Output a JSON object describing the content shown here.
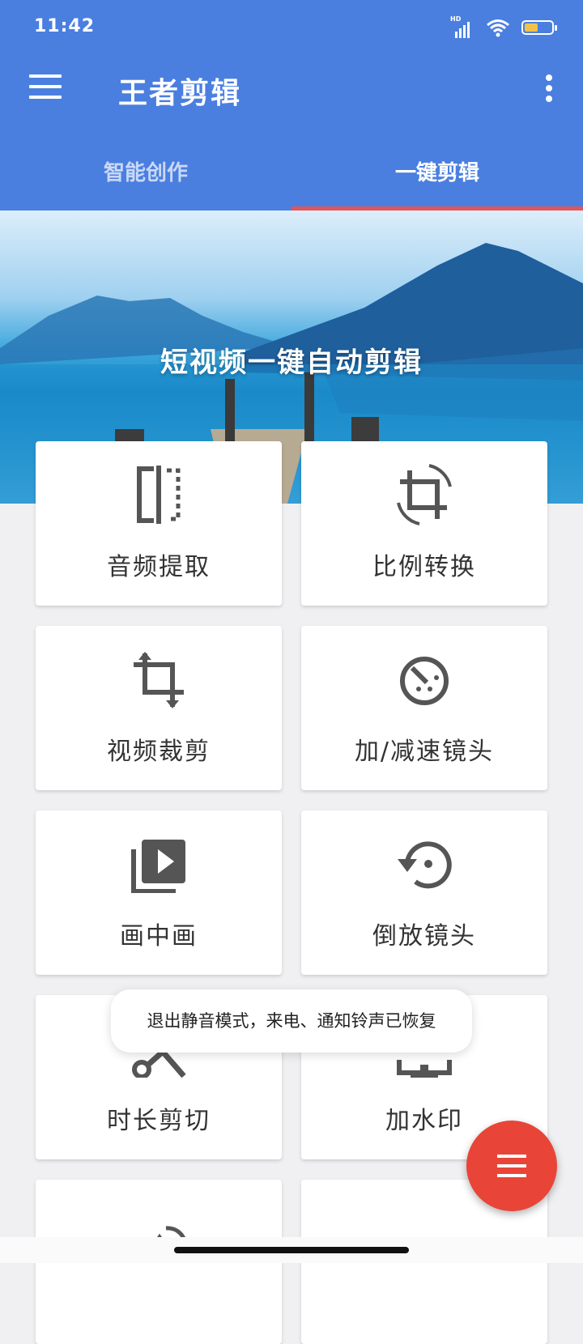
{
  "status": {
    "time": "11:42",
    "hd_label": "HD",
    "battery_level": 0.5
  },
  "app": {
    "title": "王者剪辑"
  },
  "tabs": [
    {
      "label": "智能创作",
      "active": false
    },
    {
      "label": "一键剪辑",
      "active": true
    }
  ],
  "banner": {
    "title": "短视频一键自动剪辑"
  },
  "tools": [
    {
      "label": "音频提取",
      "icon": "audio-extract-icon"
    },
    {
      "label": "比例转换",
      "icon": "ratio-rotate-crop-icon"
    },
    {
      "label": "视频裁剪",
      "icon": "crop-icon"
    },
    {
      "label": "加/减速镜头",
      "icon": "speed-timer-icon"
    },
    {
      "label": "画中画",
      "icon": "picture-in-picture-icon"
    },
    {
      "label": "倒放镜头",
      "icon": "reverse-icon"
    },
    {
      "label": "时长剪切",
      "icon": "scissors-icon"
    },
    {
      "label": "加水印",
      "icon": "watermark-icon"
    },
    {
      "label": "",
      "icon": "rotate-icon"
    },
    {
      "label": "",
      "icon": "person-icon"
    }
  ],
  "toast": {
    "message": "退出静音模式，来电、通知铃声已恢复"
  },
  "colors": {
    "primary": "#4a7fe0",
    "tab_indicator": "#e0565a",
    "fab": "#e84538",
    "icon": "#555555"
  }
}
